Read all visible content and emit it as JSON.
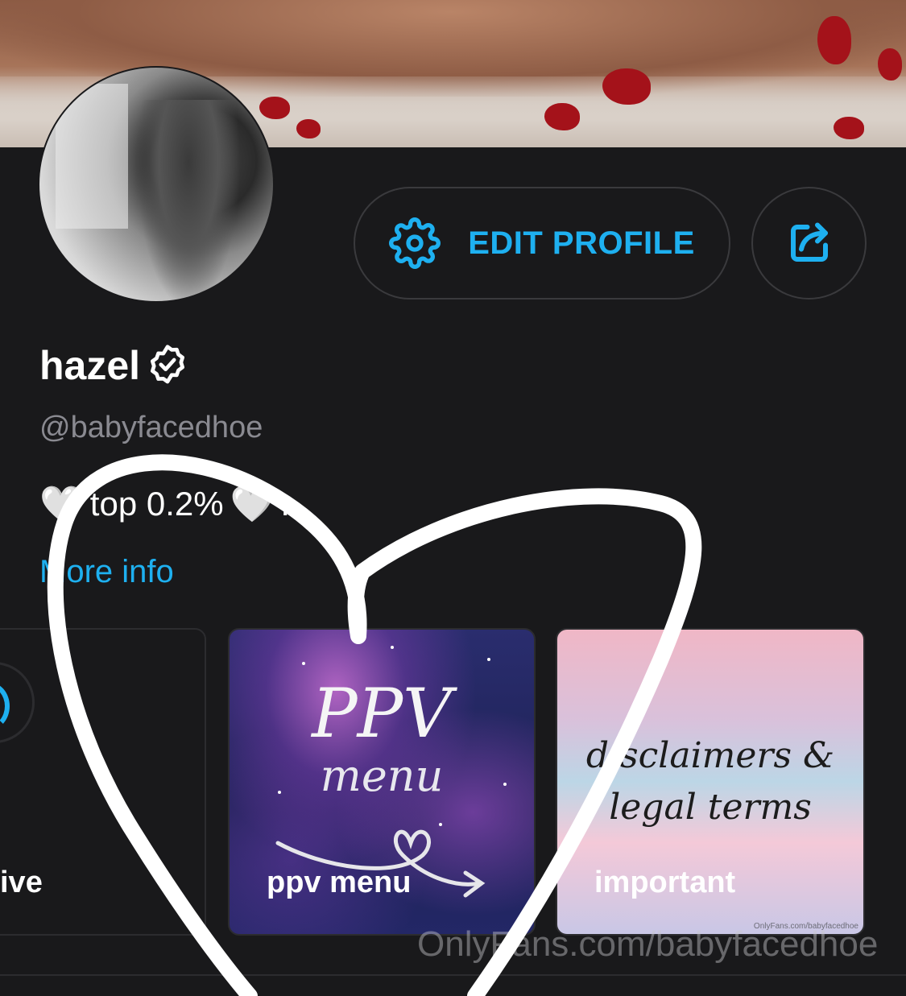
{
  "profile": {
    "name": "hazel",
    "handle": "@babyfacedhoe",
    "bio_text": "top 0.2%",
    "bio_trail": "..",
    "bio_heart": "🤍",
    "more_info": "More info"
  },
  "actions": {
    "edit_profile_label": "EDIT PROFILE",
    "edit_icon": "gear-icon",
    "share_icon": "share-icon"
  },
  "highlights": [
    {
      "label": "ive"
    },
    {
      "label": "ppv menu",
      "cover_title": "PPV",
      "cover_subtitle": "menu"
    },
    {
      "label": "important",
      "cover_text_line1": "disclaimers &",
      "cover_text_line2": "legal terms",
      "cover_small": "OnlyFans.com/babyfacedhoe"
    }
  ],
  "watermark": "OnlyFans.com/babyfacedhoe",
  "colors": {
    "accent": "#1eb0f0",
    "background": "#19191b",
    "muted": "#8a8a91"
  }
}
